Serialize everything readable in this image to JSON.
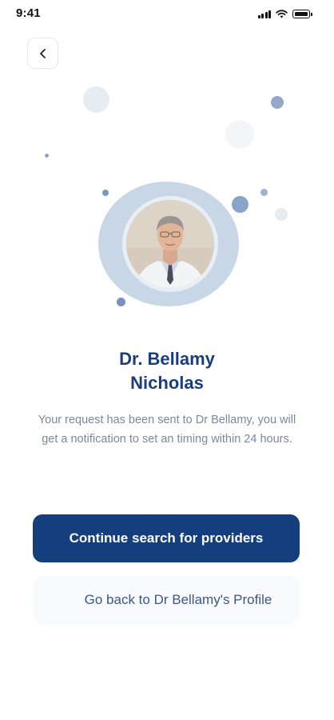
{
  "status_bar": {
    "time": "9:41",
    "icons": [
      "signal-icon",
      "wifi-icon",
      "battery-icon"
    ]
  },
  "header": {
    "back_icon": "chevron-left-icon"
  },
  "doctor": {
    "name_line1": "Dr. Bellamy",
    "name_line2": "Nicholas"
  },
  "message": {
    "text": "Your request has been sent to Dr Bellamy, you will get a notification to set an timing within 24 hours."
  },
  "actions": {
    "primary_label": "Continue search for providers",
    "secondary_label": "Go back to Dr Bellamy's Profile"
  },
  "colors": {
    "primary": "#143e7c",
    "name": "#1b3d7a",
    "body_text": "#7d879c",
    "secondary_bg": "#f8fafd"
  }
}
